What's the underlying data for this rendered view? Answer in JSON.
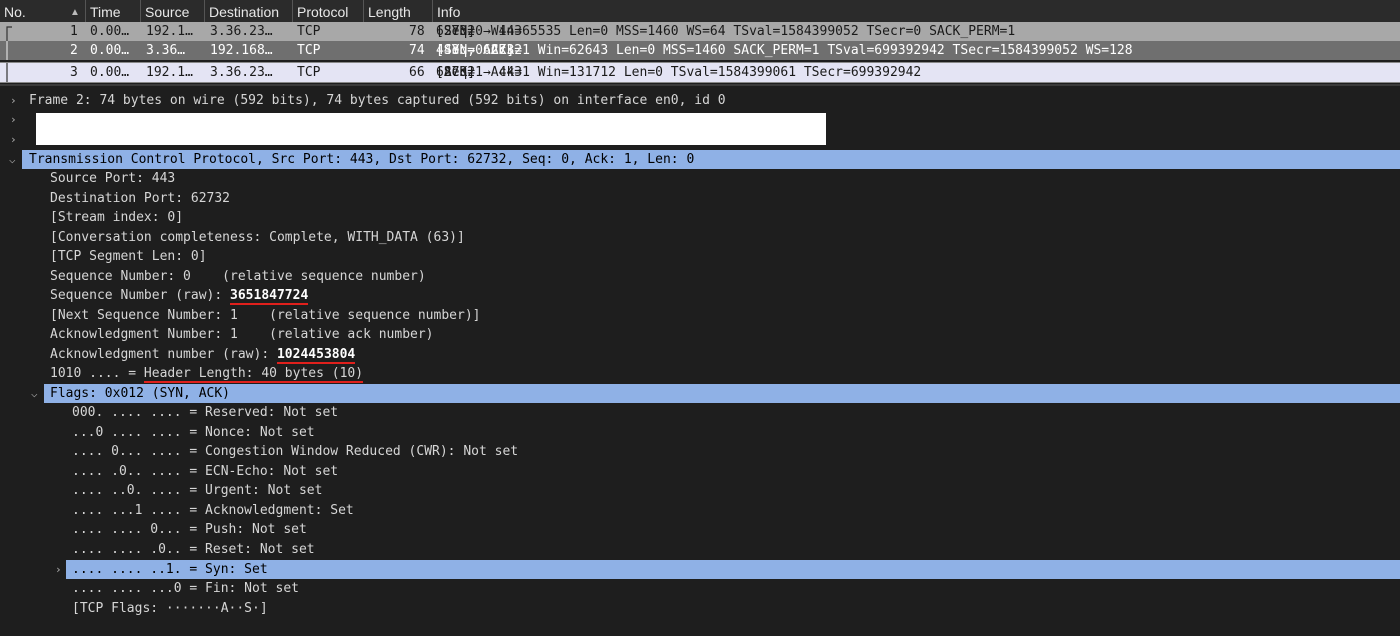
{
  "columns": [
    {
      "label": "No."
    },
    {
      "label": "Time"
    },
    {
      "label": "Source"
    },
    {
      "label": "Destination"
    },
    {
      "label": "Protocol"
    },
    {
      "label": "Length"
    },
    {
      "label": "Info"
    }
  ],
  "packets": [
    {
      "no": "1",
      "time": "0.00…",
      "source": "192.1…",
      "destination": "3.36.23…",
      "protocol": "TCP",
      "length": "78",
      "info_pre": "62732 → 443 ",
      "info_flag": "[SYN]",
      "info_post": " Seq=0 Win=65535 Len=0 MSS=1460 WS=64 TSval=1584399052 TSecr=0 SACK_PERM=1"
    },
    {
      "no": "2",
      "time": "0.00…",
      "source": "3.36…",
      "destination": "192.168…",
      "protocol": "TCP",
      "length": "74",
      "info_pre": "443 → 62732 ",
      "info_flag": "[SYN, ACK]",
      "info_post": " Seq=0 Ack=1 Win=62643 Len=0 MSS=1460 SACK_PERM=1 TSval=699392942 TSecr=1584399052 WS=128"
    },
    {
      "no": "3",
      "time": "0.00…",
      "source": "192.1…",
      "destination": "3.36.23…",
      "protocol": "TCP",
      "length": "66",
      "info_pre": "62732 → 443 ",
      "info_flag": "[ACK]",
      "info_post": " Seq=1 Ack=1 Win=131712 Len=0 TSval=1584399061 TSecr=699392942"
    }
  ],
  "details": {
    "frame": "Frame 2: 74 bytes on wire (592 bits), 74 bytes captured (592 bits) on interface en0, id 0",
    "tcp_header": "Transmission Control Protocol, Src Port: 443, Dst Port: 62732, Seq: 0, Ack: 1, Len: 0",
    "tcp_fields": [
      "Source Port: 443",
      "Destination Port: 62732",
      "[Stream index: 0]",
      "[Conversation completeness: Complete, WITH_DATA (63)]",
      "[TCP Segment Len: 0]",
      "Sequence Number: 0    (relative sequence number)"
    ],
    "seq_raw_label": "Sequence Number (raw): ",
    "seq_raw_value": "3651847724",
    "next_seq": "[Next Sequence Number: 1    (relative sequence number)]",
    "ack_num": "Acknowledgment Number: 1    (relative ack number)",
    "ack_raw_label": "Acknowledgment number (raw): ",
    "ack_raw_value": "1024453804",
    "header_len_pre": "1010 .... = ",
    "header_len_value": "Header Length: 40 bytes (10)",
    "flags_header": "Flags: 0x012 (SYN, ACK)",
    "flags": [
      "000. .... .... = Reserved: Not set",
      "...0 .... .... = Nonce: Not set",
      ".... 0... .... = Congestion Window Reduced (CWR): Not set",
      ".... .0.. .... = ECN-Echo: Not set",
      ".... ..0. .... = Urgent: Not set",
      ".... ...1 .... = Acknowledgment: Set",
      ".... .... 0... = Push: Not set",
      ".... .... .0.. = Reset: Not set",
      ".... .... ..1. = Syn: Set",
      ".... .... ...0 = Fin: Not set",
      "[TCP Flags: ·······A··S·]"
    ]
  }
}
